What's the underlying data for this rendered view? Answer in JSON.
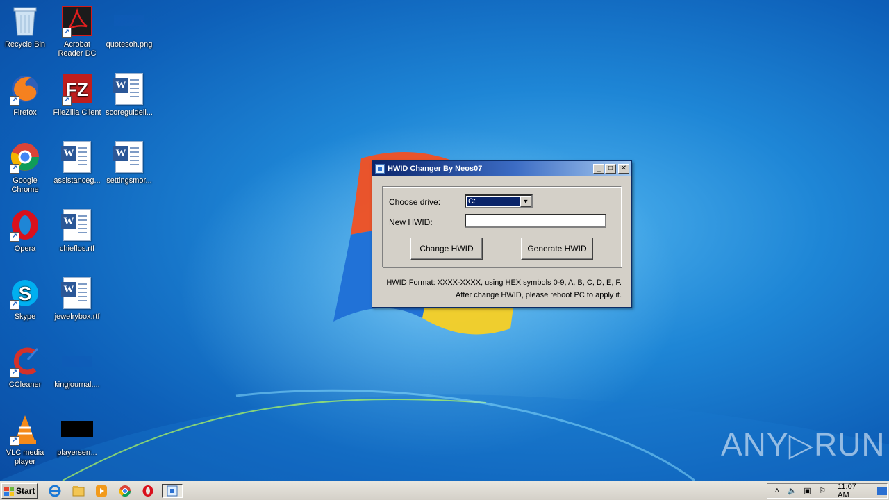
{
  "desktop_icons": [
    {
      "label": "Recycle Bin",
      "icon": "recycle-bin-icon"
    },
    {
      "label": "Acrobat Reader DC",
      "icon": "acrobat-icon"
    },
    {
      "label": "quotesoh.png",
      "icon": "image-file-icon"
    },
    {
      "label": "Firefox",
      "icon": "firefox-icon"
    },
    {
      "label": "FileZilla Client",
      "icon": "filezilla-icon"
    },
    {
      "label": "scoreguideli...",
      "icon": "word-document-icon"
    },
    {
      "label": "Google Chrome",
      "icon": "chrome-icon"
    },
    {
      "label": "assistanceg...",
      "icon": "word-document-icon"
    },
    {
      "label": "settingsmor...",
      "icon": "word-document-icon"
    },
    {
      "label": "Opera",
      "icon": "opera-icon"
    },
    {
      "label": "chieflos.rtf",
      "icon": "word-document-icon"
    },
    {
      "label": "Skype",
      "icon": "skype-icon"
    },
    {
      "label": "jewelrybox.rtf",
      "icon": "word-document-icon"
    },
    {
      "label": "CCleaner",
      "icon": "ccleaner-icon"
    },
    {
      "label": "kingjournal....",
      "icon": "image-file-icon"
    },
    {
      "label": "VLC media player",
      "icon": "vlc-icon"
    },
    {
      "label": "playerserr...",
      "icon": "image-file-icon"
    }
  ],
  "dialog": {
    "title": "HWID Changer By Neos07",
    "minimize": "_",
    "maximize": "□",
    "close": "✕",
    "choose_drive_label": "Choose drive:",
    "drive_value": "C:",
    "new_hwid_label": "New HWID:",
    "new_hwid_value": "",
    "change_button": "Change HWID",
    "generate_button": "Generate HWID",
    "info_line1": "HWID Format: XXXX-XXXX, using HEX symbols 0-9, A, B, C, D, E, F.",
    "info_line2": "After change HWID, please reboot PC to apply it."
  },
  "watermark": "ANY▷RUN",
  "taskbar": {
    "start_label": "Start",
    "apps": [
      "internet-explorer-icon",
      "file-explorer-icon",
      "media-player-icon",
      "chrome-icon",
      "opera-icon",
      "hwid-changer-icon"
    ],
    "clock": "11:07 AM"
  }
}
